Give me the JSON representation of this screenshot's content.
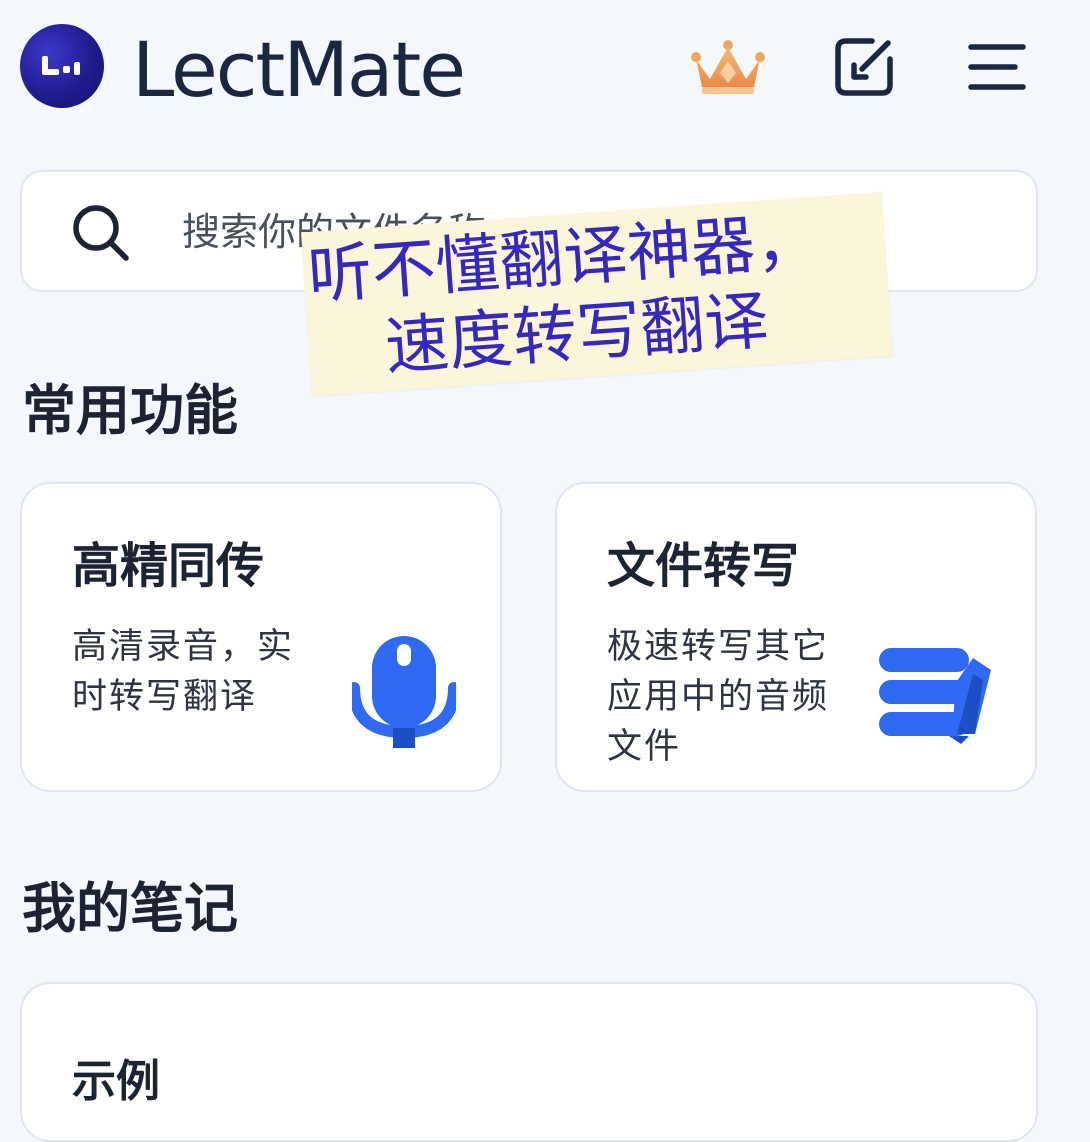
{
  "header": {
    "app_name": "LectMate",
    "logo_icon": "lectmate-logo-icon",
    "crown_icon": "crown-icon",
    "import_icon": "import-file-icon",
    "menu_icon": "hamburger-menu-icon"
  },
  "search": {
    "placeholder": "搜索你的文件名称",
    "icon": "search-icon"
  },
  "overlay": {
    "line1": "听不懂翻译神器，",
    "line2": "速度转写翻译"
  },
  "sections": {
    "common": "常用功能",
    "notes": "我的笔记"
  },
  "features": [
    {
      "title": "高精同传",
      "description": "高清录音，实时转写翻译",
      "icon": "microphone-icon"
    },
    {
      "title": "文件转写",
      "description": "极速转写其它应用中的音频文件",
      "icon": "file-transcribe-icon"
    }
  ],
  "notes": [
    {
      "title": "示例"
    }
  ],
  "colors": {
    "accent_blue": "#2e6bf2",
    "logo_navy": "#1f1c8f",
    "crown_orange": "#f0a35e",
    "overlay_text": "#3527c2",
    "overlay_bg": "#fbf5d9",
    "page_bg": "#f4f8fd"
  }
}
